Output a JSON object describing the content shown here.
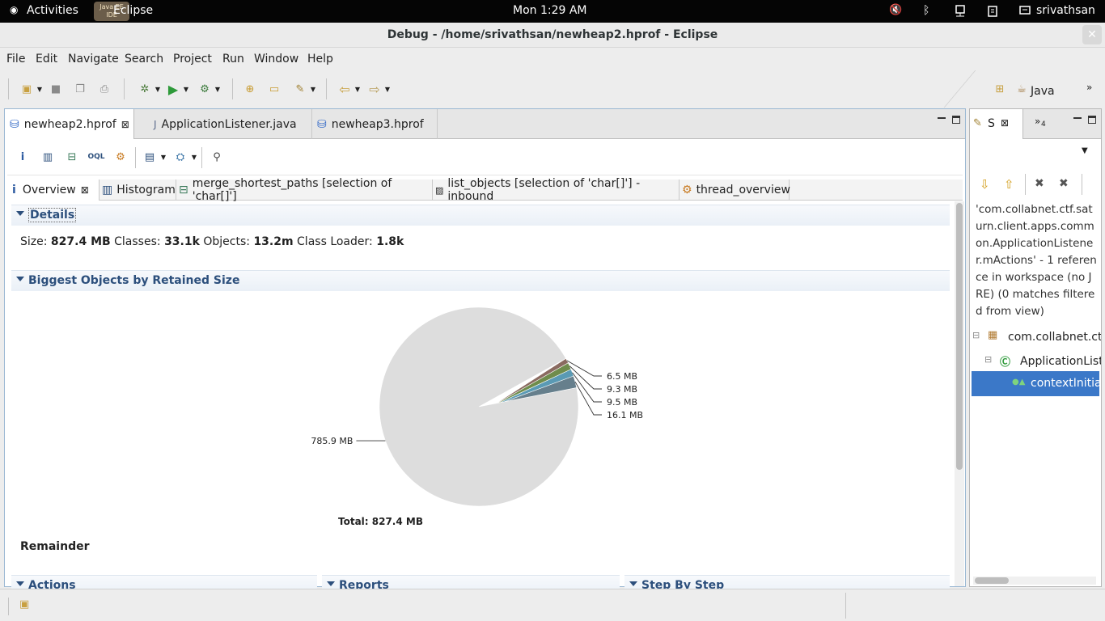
{
  "topbar": {
    "activities": "Activities",
    "app_name": "Eclipse",
    "app_icon_text": "Java EE IDE",
    "clock": "Mon  1:29 AM",
    "user": "srivathsan"
  },
  "window": {
    "title": "Debug - /home/srivathsan/newheap2.hprof - Eclipse"
  },
  "menu": [
    "File",
    "Edit",
    "Navigate",
    "Search",
    "Project",
    "Run",
    "Window",
    "Help"
  ],
  "perspective": {
    "label": "Java",
    "more": "»"
  },
  "editor_tabs": [
    {
      "label": "newheap2.hprof",
      "active": true
    },
    {
      "label": "ApplicationListener.java",
      "active": false
    },
    {
      "label": "newheap3.hprof",
      "active": false
    }
  ],
  "sub_tabs": [
    {
      "label": "Overview"
    },
    {
      "label": "Histogram"
    },
    {
      "label": "merge_shortest_paths [selection of 'char[]']"
    },
    {
      "label": "list_objects [selection of 'char[]'] -inbound"
    },
    {
      "label": "thread_overview"
    }
  ],
  "details": {
    "heading": "Details",
    "size_label": "Size:",
    "size_value": "827.4 MB",
    "classes_label": "Classes:",
    "classes_value": "33.1k",
    "objects_label": "Objects:",
    "objects_value": "13.2m",
    "loader_label": "Class Loader:",
    "loader_value": "1.8k"
  },
  "biggest": {
    "heading": "Biggest Objects by Retained Size",
    "total": "Total: 827.4 MB",
    "remainder": "Remainder"
  },
  "chart_data": {
    "type": "pie",
    "unit": "MB",
    "slices": [
      {
        "label": "16.1 MB",
        "value": 16.1,
        "color": "#667f8c"
      },
      {
        "label": "9.5 MB",
        "value": 9.5,
        "color": "#5a9ab4"
      },
      {
        "label": "9.3 MB",
        "value": 9.3,
        "color": "#6f8c4c"
      },
      {
        "label": "6.5 MB",
        "value": 6.5,
        "color": "#8a6a60"
      },
      {
        "label": "785.9 MB",
        "value": 785.9,
        "color": "#dddddd"
      }
    ],
    "title": "",
    "total": "Total: 827.4 MB"
  },
  "bottom_sections": [
    "Actions",
    "Reports",
    "Step By Step"
  ],
  "search_view": {
    "tab": "S",
    "tab_count": "4",
    "message": "'com.collabnet.ctf.saturn.client.apps.common.ApplicationListener.mActions' - 1 reference in workspace (no JRE) (0 matches filtered from view)",
    "tree": [
      {
        "label": "com.collabnet.ctf",
        "level": 0
      },
      {
        "label": "ApplicationListe",
        "level": 1
      },
      {
        "label": "contextInitia",
        "level": 2,
        "selected": true
      }
    ]
  },
  "colors": {
    "selection": "#3b78c8",
    "section_text": "#2c4f7c",
    "editor_border": "#9bb8d3"
  }
}
